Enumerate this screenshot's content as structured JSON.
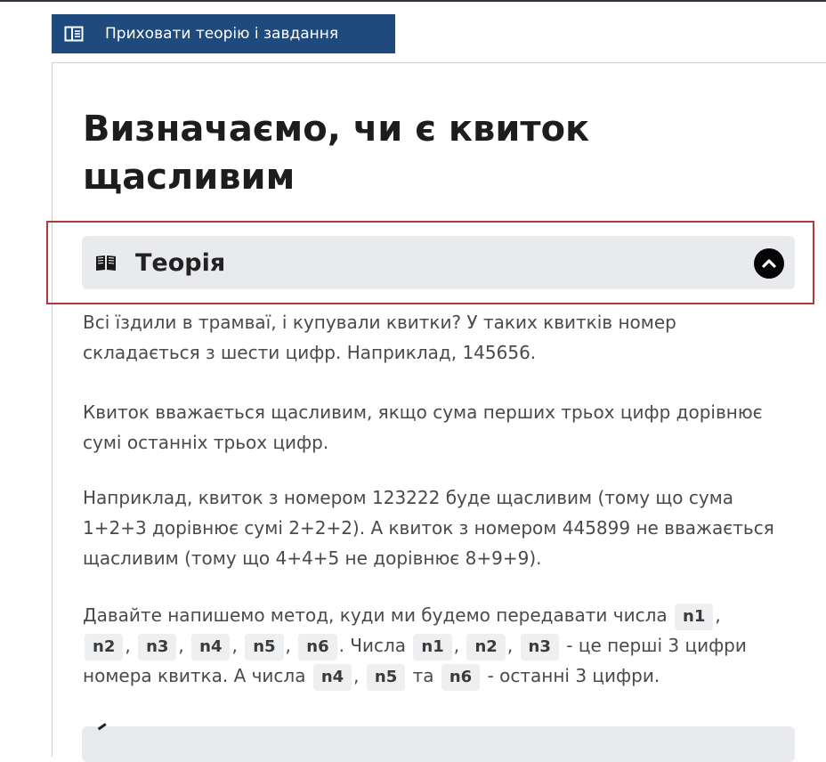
{
  "toolbar": {
    "toggle_label": "Приховати теорію і завдання"
  },
  "lesson": {
    "title": "Визначаємо, чи є квиток щасливим"
  },
  "theory": {
    "header": "Теорія",
    "p1": "Всі їздили в трамваї, і купували квитки? У таких квитків номер складається з шести цифр. Наприклад, 145656.",
    "p2": "Квиток вважається щасливим, якщо сума перших трьох цифр дорівнює сумі останніх трьох цифр.",
    "p3": "Наприклад, квиток з номером 123222 буде щасливим (тому що сума 1+2+3 дорівнює сумі 2+2+2). А квиток з номером 445899 не вважається щасливим (тому що 4+4+5 не дорівнює 8+9+9).",
    "p4": {
      "t1": "Давайте напишемо метод, куди ми будемо передавати числа",
      "c_n1": "n1",
      "c_n2": "n2",
      "c_n3": "n3",
      "c_n4": "n4",
      "c_n5": "n5",
      "c_n6": "n6",
      "comma": ",",
      "t2": ". Числа",
      "t3": "- це перші 3 цифри",
      "t4": "номера квитка. А числа",
      "t5": "та",
      "t6": "- останні 3 цифри."
    }
  },
  "icons": {
    "toggle": "sidebar-panel-icon",
    "theory": "book-icon",
    "collapse": "chevron-up-circle-icon"
  },
  "colors": {
    "button_bg": "#1e4a7e",
    "header_bg": "#e9eaee",
    "highlight_border": "#b03a3a",
    "code_bg": "#eeeff1"
  }
}
